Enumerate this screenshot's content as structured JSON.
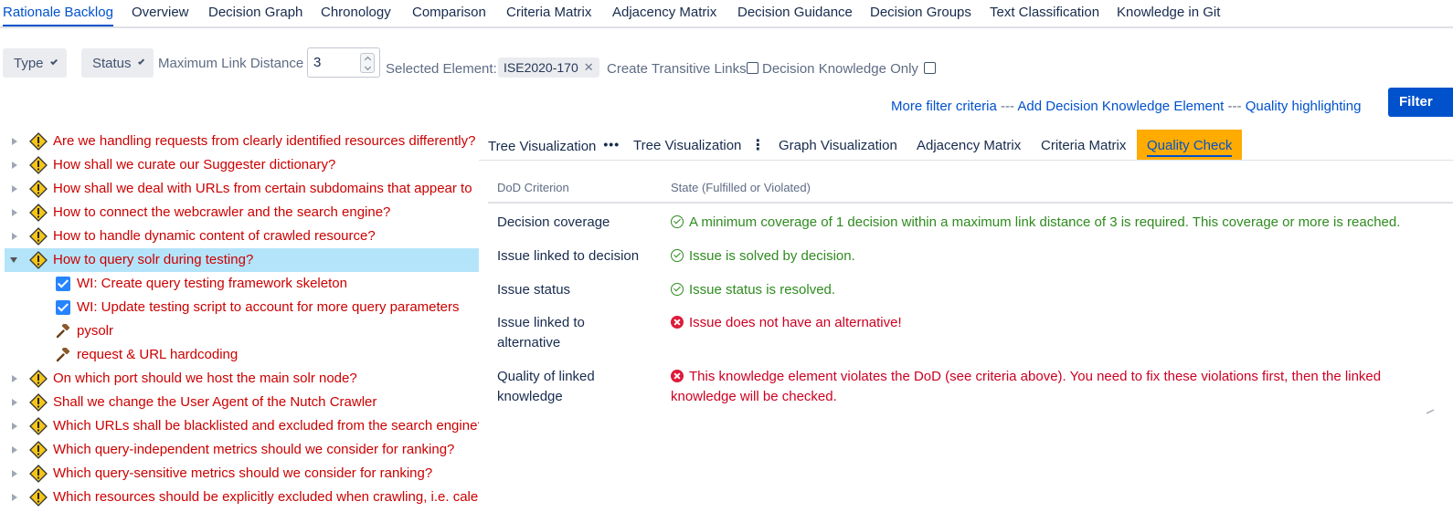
{
  "nav": {
    "tabs": [
      {
        "label": "Rationale Backlog",
        "active": true
      },
      {
        "label": "Overview"
      },
      {
        "label": "Decision Graph"
      },
      {
        "label": "Chronology"
      },
      {
        "label": "Comparison"
      },
      {
        "label": "Criteria Matrix"
      },
      {
        "label": "Adjacency Matrix"
      },
      {
        "label": "Decision Guidance"
      },
      {
        "label": "Decision Groups"
      },
      {
        "label": "Text Classification"
      },
      {
        "label": "Knowledge in Git"
      }
    ]
  },
  "filters": {
    "type_label": "Type",
    "status_label": "Status",
    "max_link_distance_label": "Maximum Link Distance",
    "max_link_distance_value": "3",
    "selected_element_label": "Selected Element:",
    "selected_element_value": "ISE2020-170",
    "create_transitive_label": "Create Transitive Links",
    "decision_knowledge_only_label": "Decision Knowledge Only",
    "more_filter_criteria": "More filter criteria",
    "add_element": "Add Decision Knowledge Element",
    "quality_highlighting": "Quality highlighting",
    "separator": "---",
    "filter_button": "Filter"
  },
  "tree": {
    "items": [
      {
        "label": "Are we handling requests from clearly identified resources differently?",
        "kind": "issue"
      },
      {
        "label": "How shall we curate our Suggester dictionary?",
        "kind": "issue"
      },
      {
        "label": "How shall we deal with URLs from certain subdomains that appear to",
        "kind": "issue"
      },
      {
        "label": "How to connect the webcrawler and the search engine?",
        "kind": "issue"
      },
      {
        "label": "How to handle dynamic content of crawled resource?",
        "kind": "issue"
      },
      {
        "label": "How to query solr during testing?",
        "kind": "issue",
        "expanded": true,
        "selected": true
      },
      {
        "label": "WI: Create query testing framework skeleton",
        "kind": "workitem"
      },
      {
        "label": "WI: Update testing script to account for more query parameters",
        "kind": "workitem"
      },
      {
        "label": "pysolr",
        "kind": "decision"
      },
      {
        "label": "request & URL hardcoding",
        "kind": "decision"
      },
      {
        "label": "On which port should we host the main solr node?",
        "kind": "issue"
      },
      {
        "label": "Shall we change the User Agent of the Nutch Crawler",
        "kind": "issue"
      },
      {
        "label": "Which URLs shall be blacklisted and excluded from the search engine?",
        "kind": "issue"
      },
      {
        "label": "Which query-independent metrics should we consider for ranking?",
        "kind": "issue"
      },
      {
        "label": "Which query-sensitive metrics should we consider for ranking?",
        "kind": "issue"
      },
      {
        "label": "Which resources should be explicitly excluded when crawling, i.e. cale",
        "kind": "issue"
      }
    ]
  },
  "view_tabs": [
    {
      "label": "Tree Visualization",
      "menu": "dots-horizontal"
    },
    {
      "label": "Tree Visualization",
      "menu": "dots-vertical"
    },
    {
      "label": "Graph Visualization"
    },
    {
      "label": "Adjacency Matrix"
    },
    {
      "label": "Criteria Matrix"
    },
    {
      "label": "Quality Check",
      "active": true
    }
  ],
  "dod": {
    "col_criterion": "DoD Criterion",
    "col_state": "State (Fulfilled or Violated)",
    "rows": [
      {
        "criterion": "Decision coverage",
        "state": "A minimum coverage of 1 decision within a maximum link distance of 3 is required. This coverage or more is reached.",
        "ok": true
      },
      {
        "criterion": "Issue linked to decision",
        "state": "Issue is solved by decision.",
        "ok": true
      },
      {
        "criterion": "Issue status",
        "state": "Issue status is resolved.",
        "ok": true
      },
      {
        "criterion": "Issue linked to alternative",
        "state": "Issue does not have an alternative!",
        "ok": false
      },
      {
        "criterion": "Quality of linked knowledge",
        "state": "This knowledge element violates the DoD (see criteria above). You need to fix these violations first, then the linked knowledge will be checked.",
        "ok": false
      }
    ]
  },
  "colors": {
    "link": "#0052cc",
    "issue_text": "#cc0000",
    "ok": "#2e8b1f",
    "violation": "#cc0022",
    "active_tab_bg": "#ffab00",
    "selected_row_bg": "#b4e4fa"
  }
}
